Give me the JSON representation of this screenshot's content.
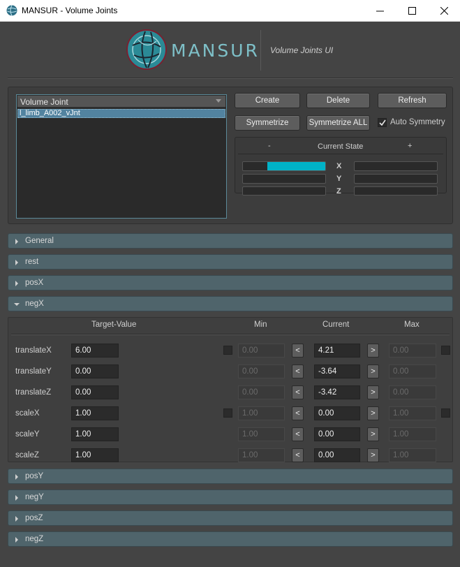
{
  "window": {
    "title": "MANSUR - Volume Joints",
    "icon": "app-globe-icon"
  },
  "header": {
    "logo_text": "MANSUR",
    "subtitle": "Volume Joints UI"
  },
  "joint_list": {
    "header": "Volume Joint",
    "items": [
      "l_limb_A002_vJnt"
    ]
  },
  "buttons": {
    "create": "Create",
    "delete": "Delete",
    "refresh": "Refresh",
    "symmetrize": "Symmetrize",
    "symmetrize_all": "Symmetrize ALL"
  },
  "auto_symmetry": {
    "label": "Auto Symmetry",
    "checked": true
  },
  "current_state": {
    "title": "Current State",
    "minus_label": "-",
    "plus_label": "+",
    "axes": [
      {
        "label": "X",
        "negative": 0.7,
        "positive": 0
      },
      {
        "label": "Y",
        "negative": 0,
        "positive": 0
      },
      {
        "label": "Z",
        "negative": 0,
        "positive": 0
      }
    ],
    "fill_color": "#00b2c7"
  },
  "sections": {
    "general": "General",
    "rest": "rest",
    "posX": "posX",
    "negX": "negX",
    "posY": "posY",
    "negY": "negY",
    "posZ": "posZ",
    "negZ": "negZ"
  },
  "negx_table": {
    "headers": {
      "target": "Target-Value",
      "min": "Min",
      "current": "Current",
      "max": "Max"
    },
    "dec_label": "<",
    "inc_label": ">",
    "rows": [
      {
        "label": "translateX",
        "target": "6.00",
        "min": "0.00",
        "current": "4.21",
        "max": "0.00"
      },
      {
        "label": "translateY",
        "target": "0.00",
        "min": "0.00",
        "current": "-3.64",
        "max": "0.00"
      },
      {
        "label": "translateZ",
        "target": "0.00",
        "min": "0.00",
        "current": "-3.42",
        "max": "0.00"
      },
      {
        "label": "scaleX",
        "target": "1.00",
        "min": "1.00",
        "current": "0.00",
        "max": "1.00"
      },
      {
        "label": "scaleY",
        "target": "1.00",
        "min": "1.00",
        "current": "0.00",
        "max": "1.00"
      },
      {
        "label": "scaleZ",
        "target": "1.00",
        "min": "1.00",
        "current": "0.00",
        "max": "1.00"
      }
    ]
  },
  "colors": {
    "accent": "#00b2c7",
    "section_bg": "#4f646b",
    "list_selection": "#5283a0"
  }
}
